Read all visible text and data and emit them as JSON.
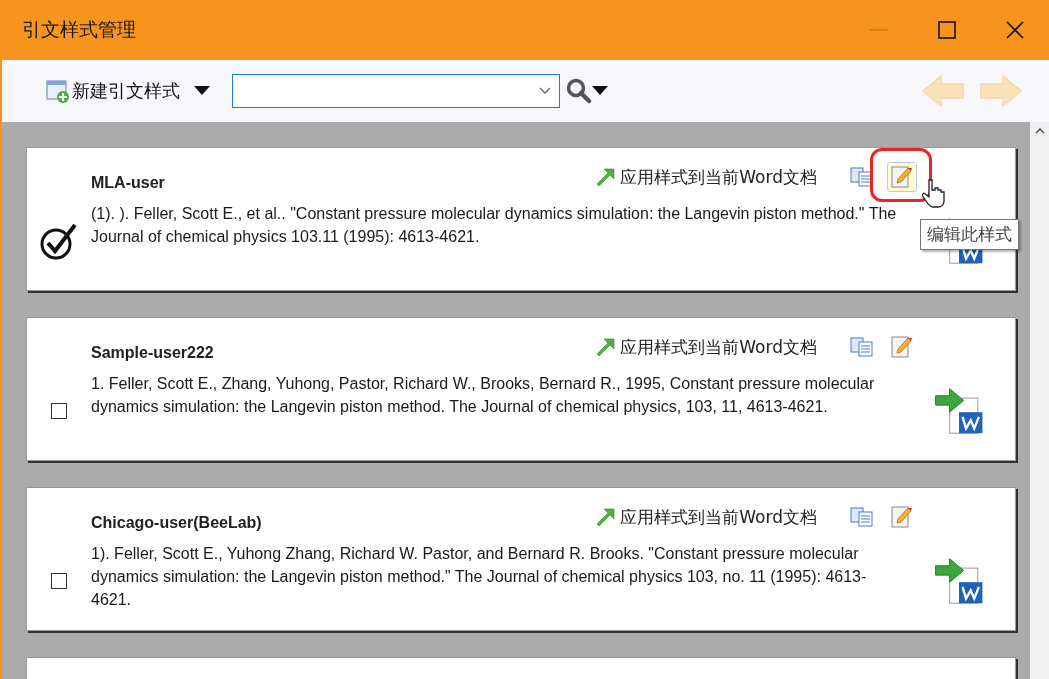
{
  "window": {
    "title": "引文样式管理"
  },
  "toolbar": {
    "new_style_label": "新建引文样式",
    "back_disabled": true,
    "forward_disabled": true
  },
  "styles": [
    {
      "name": "MLA-user",
      "selected": true,
      "apply_label": "应用样式到当前Word文档",
      "citation": "(1). ). Feller, Scott E., et al.. \"Constant pressure molecular dynamics simulation: the Langevin piston method.\" The Journal of chemical physics 103.11 (1995): 4613-4621.",
      "edit_hovered": true,
      "tooltip": "编辑此样式"
    },
    {
      "name": "Sample-user222",
      "selected": false,
      "apply_label": "应用样式到当前Word文档",
      "citation": "1. Feller, Scott E., Zhang, Yuhong, Pastor, Richard W., Brooks, Bernard R., 1995, Constant pressure molecular dynamics simulation: the Langevin piston method. The Journal of chemical physics, 103, 11, 4613-4621.",
      "edit_hovered": false
    },
    {
      "name": "Chicago-user(BeeLab)",
      "selected": false,
      "apply_label": "应用样式到当前Word文档",
      "citation": "1). Feller, Scott E., Yuhong Zhang, Richard W. Pastor, and Bernard R. Brooks. \"Constant pressure molecular dynamics simulation: the Langevin piston method.\" The Journal of chemical physics 103, no. 11 (1995): 4613-4621.",
      "edit_hovered": false
    }
  ]
}
